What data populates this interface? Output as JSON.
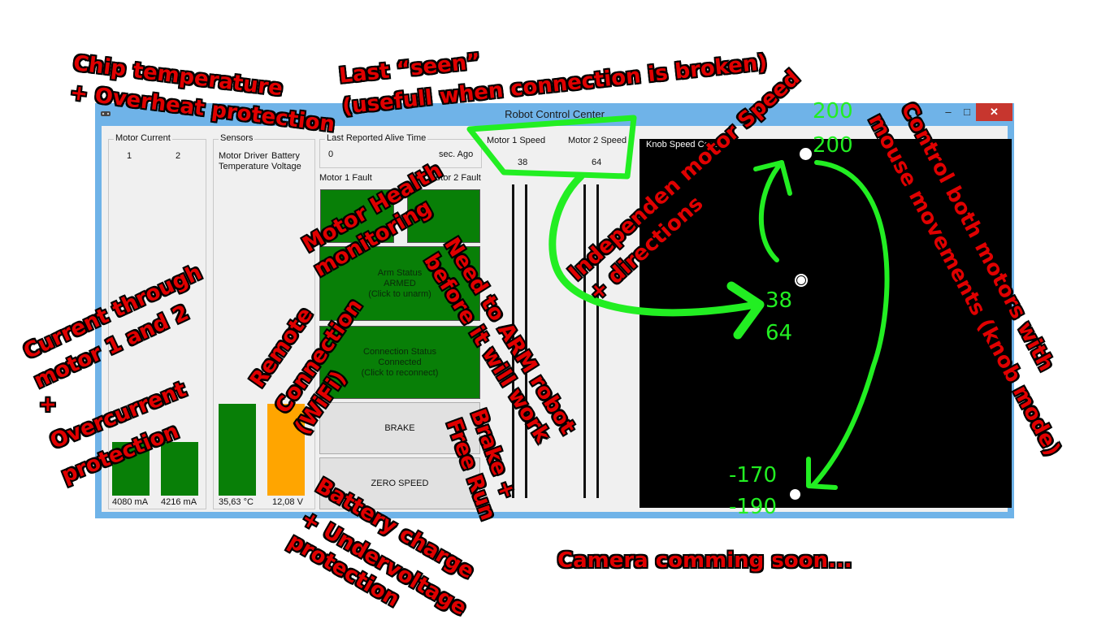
{
  "window": {
    "title": "Robot Control Center",
    "minimize": "–",
    "maximize": "□",
    "close": "✕"
  },
  "motor_current": {
    "label": "Motor Current",
    "col1": "1",
    "col2": "2",
    "bar_color": "#087f07",
    "value1": "4080 mA",
    "value2": "4216 mA"
  },
  "sensors": {
    "label": "Sensors",
    "col1_line1": "Motor Driver",
    "col1_line2": "Temperature",
    "col2_line1": "Battery",
    "col2_line2": "Voltage",
    "temp_value": "35,63 °C",
    "voltage_value": "12,08 V",
    "temp_color": "#087f07",
    "voltage_color": "#ffa500"
  },
  "alive": {
    "label": "Last Reported Alive Time",
    "value": "0",
    "unit": "sec. Ago"
  },
  "faults": {
    "motor1": "Motor 1 Fault",
    "motor2": "Motor 2 Fault"
  },
  "arm": {
    "line1": "Arm Status",
    "line2": "ARMED",
    "line3": "(Click to unarm)"
  },
  "connection": {
    "line1": "Connection Status",
    "line2": "Connected",
    "line3": "(Click to reconnect)"
  },
  "buttons": {
    "brake": "BRAKE",
    "zero_speed": "ZERO SPEED"
  },
  "speed": {
    "motor1_label": "Motor 1 Speed",
    "motor2_label": "Motor 2 Speed",
    "motor1_value": "38",
    "motor2_value": "64"
  },
  "knob": {
    "label": "Knob Speed Control"
  },
  "annotations": {
    "chip_l1": "Chip temperature",
    "chip_l2": "+ Overheat protection",
    "last_seen_l1": "Last “seen”",
    "last_seen_l2": "(usefull when connection is broken)",
    "current_l1": "Current through",
    "current_l2": "motor 1 and 2",
    "current_l3": "+",
    "current_l4": "Overcurrent",
    "current_l5": "protection",
    "health_l1": "Motor Health",
    "health_l2": "monitoring",
    "remote_l1": "Remote",
    "remote_l2": "Connection",
    "remote_l3": "(WiFi)",
    "arm_l1": "Need to ARM robot",
    "arm_l2": "before it will work",
    "brake_l1": "Brake +",
    "brake_l2": "Free Run",
    "battery_l1": "Battery charge",
    "battery_l2": "+ Undervoltage",
    "battery_l3": "protection",
    "indep_l1": "Independen motor Speed",
    "indep_l2": "+ directions",
    "control_l1": "Control both motors with",
    "control_l2": "mouse movements (knob mode)",
    "camera": "Camera comming soon..."
  },
  "knob_numbers": {
    "top1": "200",
    "top2": "200",
    "mid1": "38",
    "mid2": "64",
    "bot1": "-170",
    "bot2": "-190",
    "color": "#22ee22"
  }
}
